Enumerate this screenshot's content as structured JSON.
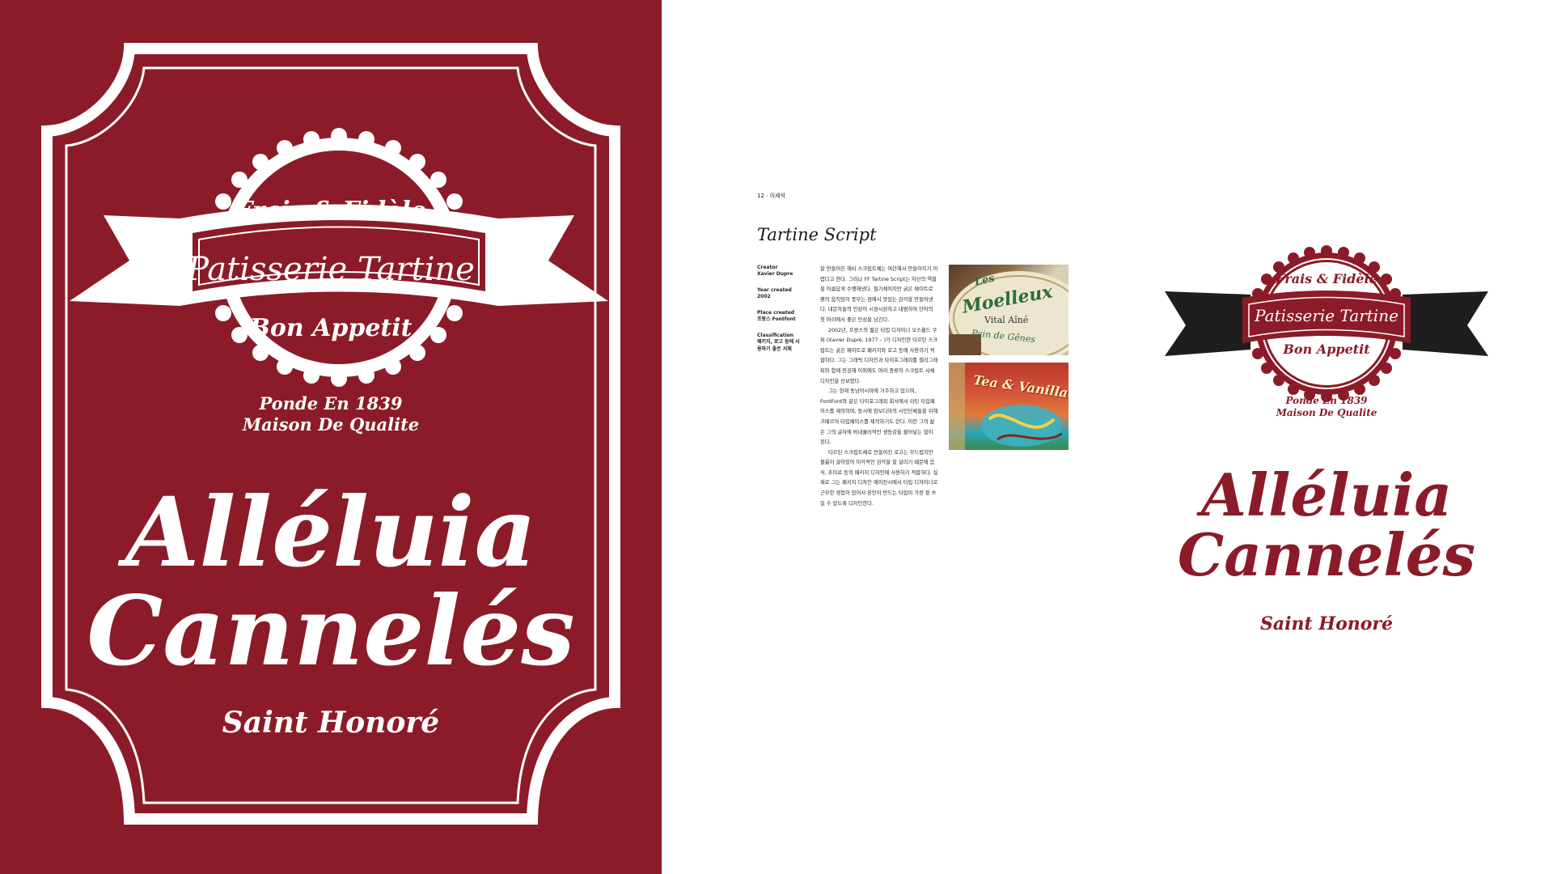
{
  "colors": {
    "brand_red": "#8b1b28",
    "white": "#ffffff",
    "ribbon_dark": "#1e1e1e",
    "text_dark": "#222222"
  },
  "poster": {
    "badge_top": "Frais & Fidèle",
    "badge_center": "Patisserie Tartine",
    "badge_bottom": "Bon Appetit",
    "est_line1": "Ponde En 1839",
    "est_line2": "Maison De Qualite",
    "headline_line1": "Alléluia",
    "headline_line2": "Cannelés",
    "footer": "Saint Honoré"
  },
  "specimen": {
    "page_number": "12 · 이세석",
    "title": "Tartine Script",
    "meta": [
      {
        "label": "Creator",
        "value": "Xavier Dupre"
      },
      {
        "label": "Year created",
        "value": "2002"
      },
      {
        "label": "Place created",
        "value": "프랑스 Fontfont"
      },
      {
        "label": "Classification",
        "value": "패키지, 로고 등에 사용하기 좋은 서체"
      }
    ],
    "body": [
      "잘 만들어진 헤비 스크립트체는 여간해서 만들어지기 어렵다고 한다. 그러나 FF Tartine Script는 자신의 역할을 아름답게 수행해낸다. 필기체이지만 굵은 웨이트로 펜의 움직임이 풍부는 점에서 맛있는 감각을 만들어낸다. 대문자들의 인상이 시원시원하고 대범하여 단어의 첫 머리에서 좋은 인상을 남긴다.",
      "2002년, 프랑스의 젊은 타입 디자이너 오스월드 쿠퍼 (Xavier Dupré, 1977 – )가 디자인한 타르틴 스크립트는 굵은 웨이트로 패키지와 로고 등에 사용하기 적합하다. 그는 그래픽 디자인과 타이포그래피를 캘리그래피와 함께 전공해 이외에도 여러 종류의 스크립트 서체 디자인을 선보였다.",
      "그는 현재 동남아시아에 거주하고 있으며, FontFont와 같은 타이포그래피 회사에서 라틴 타입페이스를 제작하며, 동시에 캄보디아의 시민단체들을 위해 크메르어 타입페이스를 제작하기도 한다. 이런 그의 삶은 그의 글자에 버내큘러적인 생동감을 불어넣는 힘이 된다.",
      "타르틴 스크립트체로 만들어진 로고는 부드럽지만 볼륨이 살아있어 미각적인 감각을 잘 살리기 때문에 음식, 초미료 등의 패키지 디자인에 사용하기 적합하다. 실제로 그는 패키지 디자인 에이전시에서 타입 디자이너로 근무한 경험이 있어서 본인이 만드는 타입이 가장 잘 쓰일 수 있도록 디자인한다."
    ],
    "photo1": {
      "line1": "Les",
      "line2": "Moelleux",
      "line3": "Vital Aîné",
      "line4": "Pain de Gênes"
    },
    "photo2": {
      "line1": "Tea & Vanilla"
    }
  },
  "logo": {
    "badge_top": "Frais & Fidèle",
    "badge_center": "Patisserie Tartine",
    "badge_bottom": "Bon Appetit",
    "est_line1": "Ponde En 1839",
    "est_line2": "Maison De Qualite",
    "headline_line1": "Alléluia",
    "headline_line2": "Cannelés",
    "footer": "Saint Honoré"
  }
}
